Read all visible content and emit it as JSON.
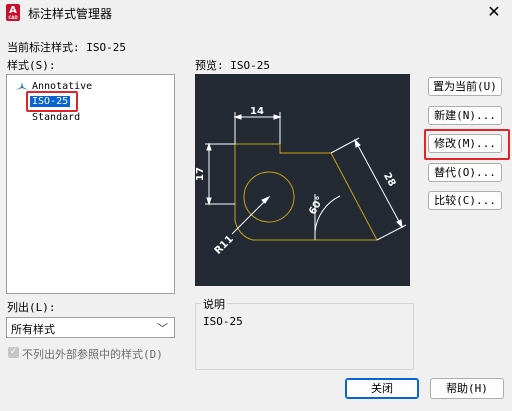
{
  "window": {
    "title": "标注样式管理器",
    "app_icon_letter": "A",
    "app_icon_sub": "CAD",
    "close_glyph": "✕"
  },
  "current_style": {
    "label": "当前标注样式: ISO-25"
  },
  "styles_list": {
    "label": "样式(S):",
    "items": [
      {
        "label": "Annotative",
        "icon": "annotative-triangle-icon"
      },
      {
        "label": "ISO-25",
        "selected": true
      },
      {
        "label": "Standard"
      }
    ]
  },
  "preview": {
    "label": "预览: ISO-25",
    "dims": {
      "top": "14",
      "left": "17",
      "slant": "28",
      "angle": "60°",
      "radius": "R11"
    }
  },
  "buttons": {
    "set_current": "置为当前(U)",
    "new": "新建(N)...",
    "modify": "修改(M)...",
    "override": "替代(O)...",
    "compare": "比较(C)...",
    "close": "关闭",
    "help": "帮助(H)"
  },
  "list_filter": {
    "label": "列出(L):",
    "value": "所有样式",
    "arrow": "﹀"
  },
  "xref_checkbox": {
    "label": "不列出外部参照中的样式(D)",
    "checked": true,
    "mark": "✓"
  },
  "description": {
    "legend": "说明",
    "text": "ISO-25"
  },
  "colors": {
    "highlight_red": "#e0242c",
    "selection_blue": "#0a64d0",
    "preview_bg": "#232a33",
    "geometry_gold": "#c8a216",
    "dimension_white": "#ffffff"
  }
}
